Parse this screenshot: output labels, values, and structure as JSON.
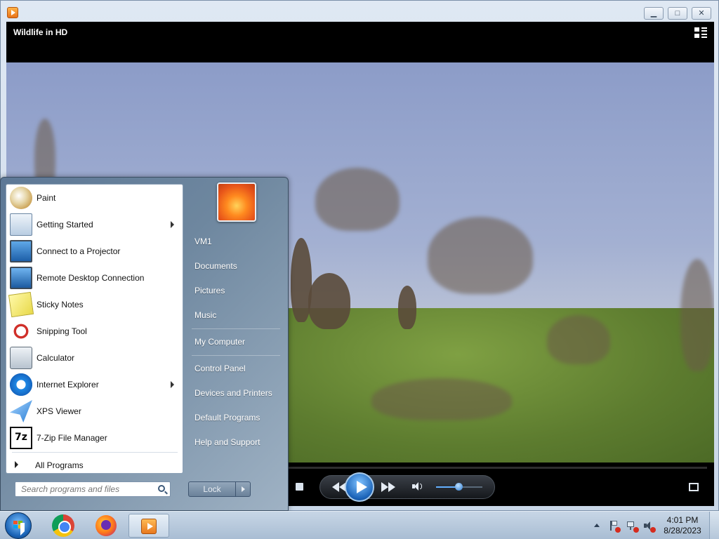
{
  "window": {
    "title": "Wildlife in HD",
    "controls": {
      "minimize": "▁",
      "maximize": "□",
      "close": "✕"
    }
  },
  "player": {
    "volume_level": 0.5,
    "icons": [
      "stop-icon",
      "rewind-icon",
      "play-icon",
      "fast-forward-icon",
      "volume-icon",
      "fullscreen-icon",
      "switch-to-library-icon"
    ]
  },
  "start_menu": {
    "programs": [
      {
        "label": "Paint",
        "icon": "paint-icon",
        "submenu": false
      },
      {
        "label": "Getting Started",
        "icon": "getting-started-icon",
        "submenu": true
      },
      {
        "label": "Connect to a Projector",
        "icon": "projector-icon",
        "submenu": false
      },
      {
        "label": "Remote Desktop Connection",
        "icon": "remote-desktop-icon",
        "submenu": false
      },
      {
        "label": "Sticky Notes",
        "icon": "sticky-notes-icon",
        "submenu": false
      },
      {
        "label": "Snipping Tool",
        "icon": "snipping-tool-icon",
        "submenu": false
      },
      {
        "label": "Calculator",
        "icon": "calculator-icon",
        "submenu": false
      },
      {
        "label": "Internet Explorer",
        "icon": "internet-explorer-icon",
        "submenu": true
      },
      {
        "label": "XPS Viewer",
        "icon": "xps-viewer-icon",
        "submenu": false
      },
      {
        "label": "7-Zip File Manager",
        "icon": "7zip-icon",
        "submenu": false
      }
    ],
    "all_programs": "All Programs",
    "search_placeholder": "Search programs and files",
    "right_items": [
      "VM1",
      "Documents",
      "Pictures",
      "Music",
      "My Computer",
      "Control Panel",
      "Devices and Printers",
      "Default Programs",
      "Help and Support"
    ],
    "lock_label": "Lock",
    "sevenzip_glyph": "7z"
  },
  "taskbar": {
    "pinned": [
      "chrome-icon",
      "firefox-icon",
      "windows-media-player-icon"
    ],
    "clock_time": "4:01 PM",
    "clock_date": "8/28/2023"
  }
}
